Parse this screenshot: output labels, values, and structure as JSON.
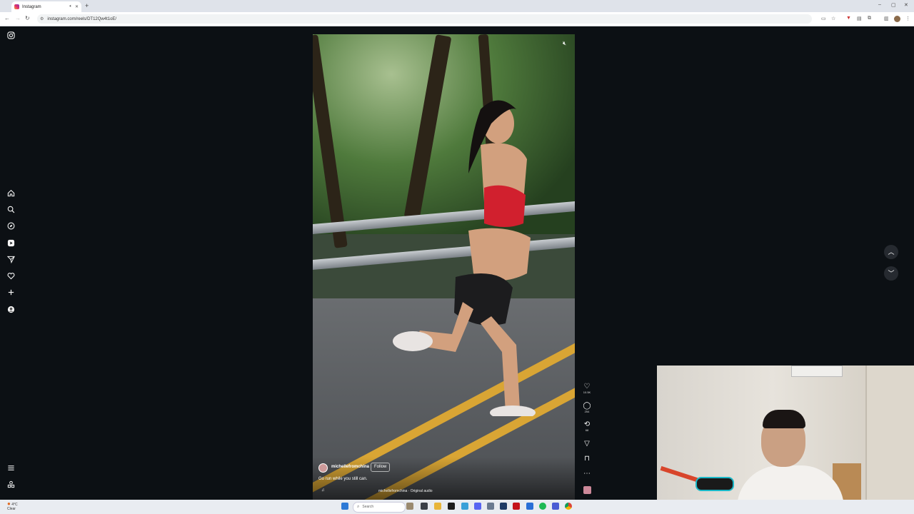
{
  "browser": {
    "tab_title": "Instagram",
    "new_tab": "+",
    "url": "instagram.com/reels/DT12Qw4t1oE/",
    "win_min": "–",
    "win_max": "▢",
    "win_close": "✕"
  },
  "nav_icons": [
    "instagram-icon",
    "home-icon",
    "search-icon",
    "explore-icon",
    "reels-icon",
    "messages-icon",
    "notifications-icon",
    "create-icon",
    "profile-icon",
    "more-menu-icon",
    "meta-icon"
  ],
  "reel": {
    "author": "michellefromchina",
    "follow_label": "Follow",
    "caption": "Go run while you still can.",
    "audio": "michellefromchina · Original audio",
    "likes": "10.5K",
    "comments": "254",
    "reposts": "68"
  },
  "taskbar": {
    "temp": "4°C",
    "condition": "Clear",
    "search_placeholder": "Search"
  },
  "colors": {
    "page_bg": "#0c1014",
    "accent_yellow": "#d9a534"
  }
}
